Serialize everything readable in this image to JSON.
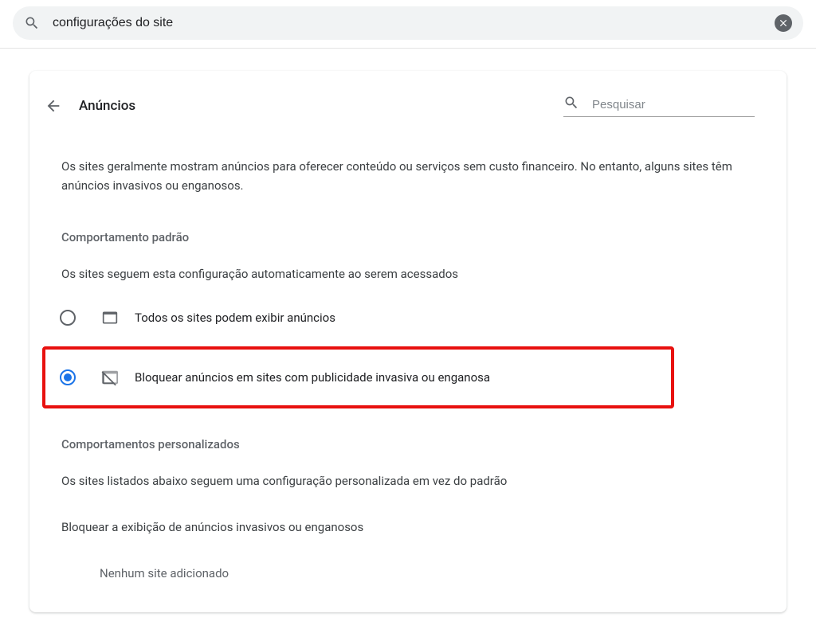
{
  "searchbar": {
    "value": "configurações do site"
  },
  "page": {
    "title": "Anúncios",
    "search_placeholder": "Pesquisar",
    "description": "Os sites geralmente mostram anúncios para oferecer conteúdo ou serviços sem custo financeiro. No entanto, alguns sites têm anúncios invasivos ou enganosos."
  },
  "defaultBehavior": {
    "title": "Comportamento padrão",
    "subtitle": "Os sites seguem esta configuração automaticamente ao serem acessados",
    "options": {
      "allow": "Todos os sites podem exibir anúncios",
      "block": "Bloquear anúncios em sites com publicidade invasiva ou enganosa"
    },
    "selected": "block"
  },
  "customBehavior": {
    "title": "Comportamentos personalizados",
    "subtitle": "Os sites listados abaixo seguem uma configuração personalizada em vez do padrão",
    "blockSection": "Bloquear a exibição de anúncios invasivos ou enganosos",
    "noSites": "Nenhum site adicionado"
  }
}
